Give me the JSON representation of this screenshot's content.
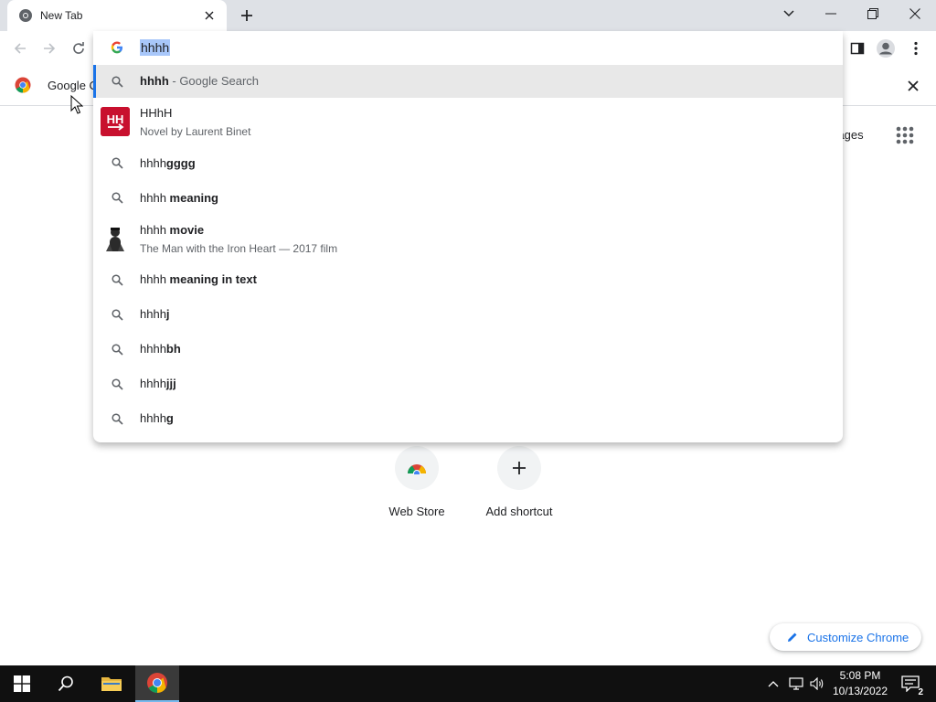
{
  "browser": {
    "tab_title": "New Tab",
    "omnibox_text": "hhhh",
    "bookmark_label": "Google C"
  },
  "suggestions": [
    {
      "type": "search",
      "query": "hhhh",
      "bold": "",
      "suffix": " - Google Search",
      "icon": "search-icon"
    },
    {
      "type": "entity",
      "title": "HHhH",
      "subtitle": "Novel by Laurent Binet",
      "icon": "book-cover"
    },
    {
      "type": "search",
      "query": "hhhh",
      "bold": "gggg",
      "icon": "search-icon"
    },
    {
      "type": "search",
      "query": "hhhh ",
      "bold": "meaning",
      "icon": "search-icon"
    },
    {
      "type": "entity",
      "query": "hhhh ",
      "bold": "movie",
      "subtitle": "The Man with the Iron Heart — 2017 film",
      "icon": "movie-poster"
    },
    {
      "type": "search",
      "query": "hhhh ",
      "bold": "meaning in text",
      "icon": "search-icon"
    },
    {
      "type": "search",
      "query": "hhhh",
      "bold": "j",
      "icon": "search-icon"
    },
    {
      "type": "search",
      "query": "hhhh",
      "bold": "bh",
      "icon": "search-icon"
    },
    {
      "type": "search",
      "query": "hhhh",
      "bold": "jjj",
      "icon": "search-icon"
    },
    {
      "type": "search",
      "query": "hhhh",
      "bold": "g",
      "icon": "search-icon"
    }
  ],
  "page": {
    "images_label": "Images",
    "shortcuts": [
      {
        "label": "Web Store",
        "icon": "chrome-web-store-icon"
      },
      {
        "label": "Add shortcut",
        "icon": "plus-icon"
      }
    ],
    "customize_label": "Customize Chrome"
  },
  "taskbar": {
    "time": "5:08 PM",
    "date": "10/13/2022",
    "notification_count": "2"
  },
  "colors": {
    "accent": "#1a73e8",
    "titlebar": "#dee1e6",
    "selection_highlight": "#a8c7fa"
  }
}
